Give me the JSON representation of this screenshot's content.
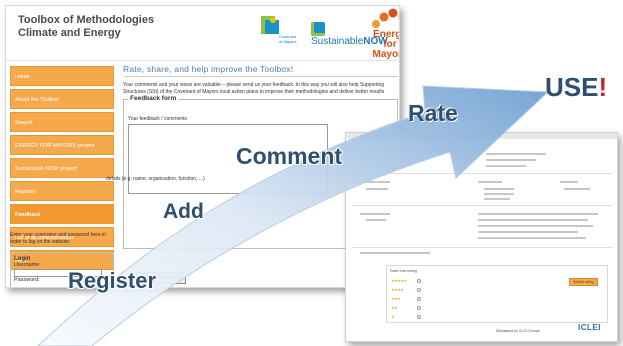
{
  "header": {
    "title": "Toolbox of Methodologies Climate and Energy",
    "logos": {
      "covenant": "Covenant of Mayors",
      "sustainable_prefix": "Sustainable",
      "sustainable_suffix": "NOW",
      "energy": "Energy for Mayors"
    }
  },
  "sidebar": {
    "items": [
      {
        "label": "Home"
      },
      {
        "label": "About the Toolbox"
      },
      {
        "label": "Search"
      },
      {
        "label": "ENERGY FOR MAYORS project"
      },
      {
        "label": "Sustainable NOW project"
      },
      {
        "label": "Register"
      },
      {
        "label": "Feedback",
        "active": true
      },
      {
        "label": "List of all methodologies"
      },
      {
        "label": "Help"
      }
    ],
    "login_note": "Enter your username and password here in order to log on the website:",
    "login_title": "Login",
    "username_label": "Username:",
    "password_label": "Password:"
  },
  "main": {
    "heading": "Rate, share, and help improve the Toolbox!",
    "intro": "Your comments and your views are valuable – please send us your feedback. In this way you will also help Supporting Structures (SSt) of the Covenant of Mayors local action plans to improve their methodologies and deliver better results",
    "form_title": "Feedback form",
    "feedback_label": "Your feedback / comments",
    "details_label": "details (e.g. name, organisation, function, ...)",
    "send_button": "Send feedback"
  },
  "rating_page": {
    "rate_header": "Rate this rating",
    "submit_rating": "Submit rating",
    "footer_note": "Maintained by ICLEI Europe",
    "iclei_logo": "ICLEI"
  },
  "steps": {
    "register": "Register",
    "add": "Add",
    "comment": "Comment",
    "rate": "Rate",
    "use": "USE",
    "use_mark": "!"
  },
  "colors": {
    "arrow_light": "#f2f6fb",
    "arrow_dark": "#6f9fd2",
    "menu_orange": "#f5a94a",
    "step_text": "#2f4f6f",
    "exclamation": "#c2272d"
  }
}
